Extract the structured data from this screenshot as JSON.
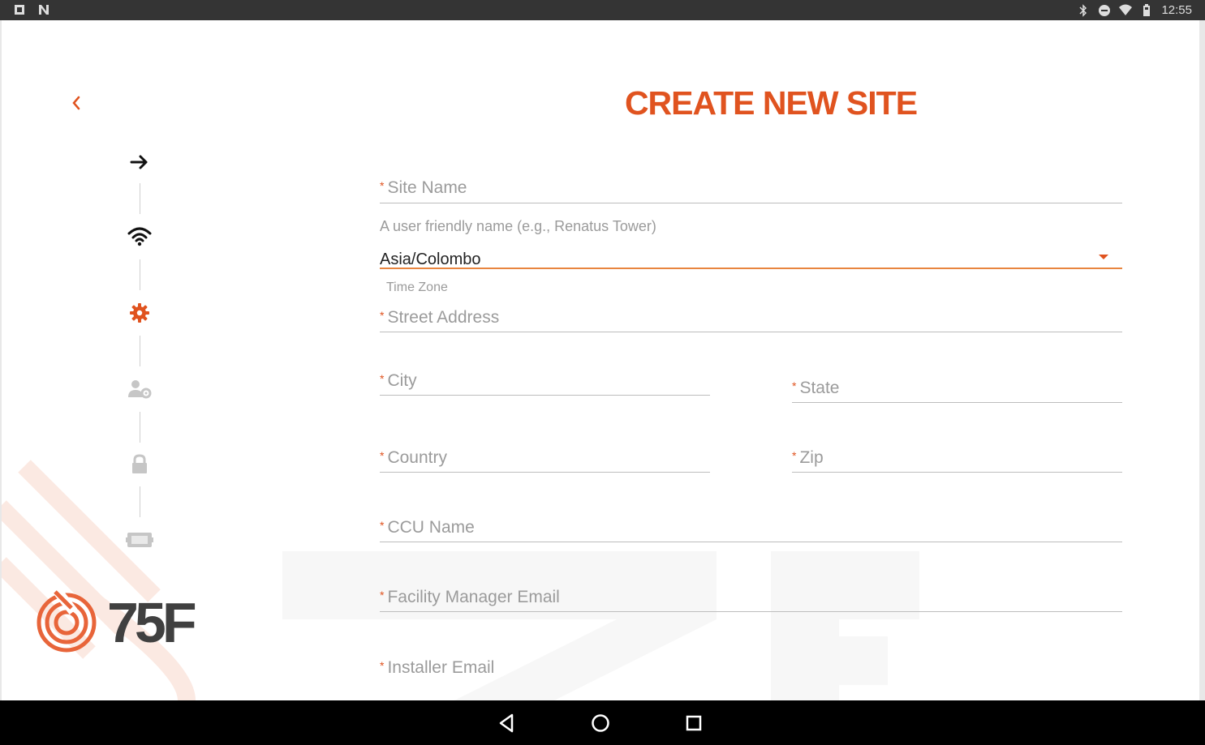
{
  "status_bar": {
    "time": "12:55"
  },
  "header": {
    "title": "CREATE NEW SITE"
  },
  "logo": {
    "text": "75F"
  },
  "form": {
    "site_name": {
      "label": "Site Name",
      "hint": "A user friendly name (e.g., Renatus Tower)"
    },
    "time_zone": {
      "value": "Asia/Colombo",
      "caption": "Time Zone"
    },
    "street_address": {
      "label": "Street Address"
    },
    "city": {
      "label": "City"
    },
    "state": {
      "label": "State"
    },
    "country": {
      "label": "Country"
    },
    "zip": {
      "label": "Zip"
    },
    "ccu_name": {
      "label": "CCU Name"
    },
    "facility_manager_email": {
      "label": "Facility Manager Email"
    },
    "installer_email": {
      "label": "Installer Email"
    },
    "required_marker": "*"
  },
  "stepper": {
    "steps": [
      {
        "icon": "arrow-right-icon"
      },
      {
        "icon": "wifi-icon"
      },
      {
        "icon": "gear-icon",
        "active": true
      },
      {
        "icon": "user-settings-icon"
      },
      {
        "icon": "lock-icon"
      },
      {
        "icon": "device-icon"
      }
    ]
  },
  "colors": {
    "accent": "#e0531f",
    "muted": "#9b9b9b",
    "status_bar": "#343434"
  }
}
